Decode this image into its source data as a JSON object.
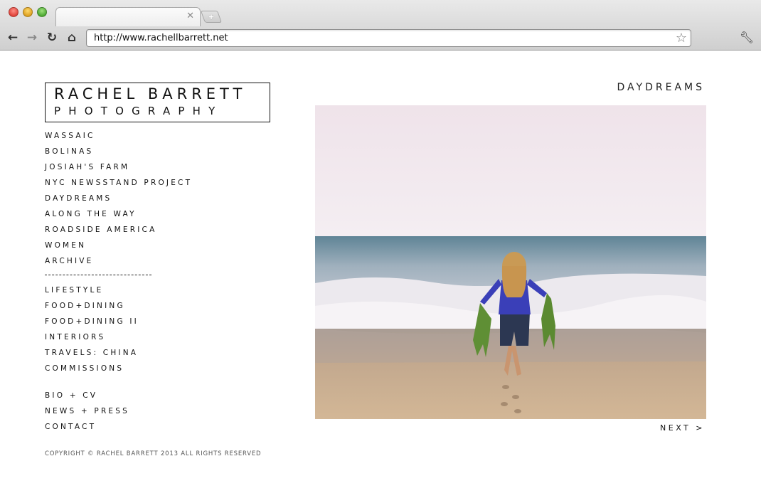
{
  "browser": {
    "url": "http://www.rachellbarrett.net",
    "icons": {
      "back": "back-arrow-icon",
      "forward": "forward-arrow-icon",
      "reload": "reload-icon",
      "home": "home-icon",
      "bookmark": "star-icon",
      "menu": "wrench-icon",
      "tab_close": "close-icon",
      "new_tab": "plus-icon"
    }
  },
  "logo": {
    "name": "RACHEL BARRETT",
    "subtitle": "PHOTOGRAPHY"
  },
  "nav": {
    "galleries": [
      "WASSAIC",
      "BOLINAS",
      "JOSIAH'S FARM",
      "NYC NEWSSTAND PROJECT",
      "DAYDREAMS",
      "ALONG THE WAY",
      "ROADSIDE AMERICA",
      "WOMEN",
      "ARCHIVE"
    ],
    "commercial": [
      "LIFESTYLE",
      "FOOD+DINING",
      "FOOD+DINING II",
      "INTERIORS",
      "TRAVELS: CHINA",
      "COMMISSIONS"
    ],
    "info": [
      "BIO + CV",
      "NEWS + PRESS",
      "CONTACT"
    ]
  },
  "gallery": {
    "title": "DAYDREAMS",
    "next_label": "NEXT >"
  },
  "footer": {
    "copyright": "COPYRIGHT © RACHEL BARRETT 2013 ALL RIGHTS RESERVED"
  },
  "colors": {
    "text": "#111111",
    "chrome": "#d6d6d6",
    "sky": "#f2e8ee",
    "sea": "#6f8fa0",
    "sand": "#c9ad8c",
    "shirt": "#3a3fb8"
  }
}
